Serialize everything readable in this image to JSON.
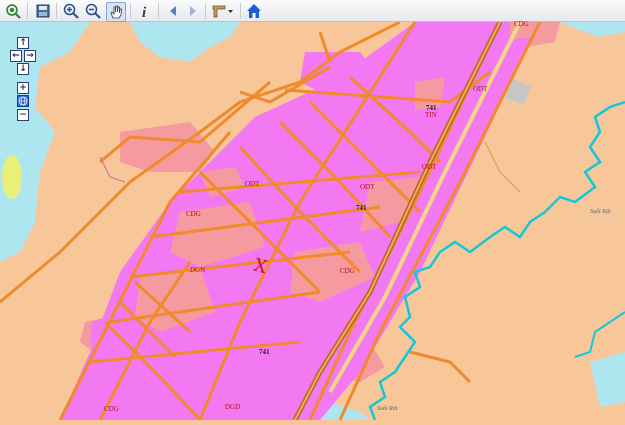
{
  "toolbar": {
    "tools": [
      "zoom-full-icon",
      "save-icon",
      "zoom-in-icon",
      "zoom-out-icon",
      "pan-hand-icon",
      "info-icon",
      "back-arrow-icon",
      "forward-arrow-icon",
      "measure-dropdown-icon",
      "home-icon"
    ]
  },
  "nav": {
    "up": "↑",
    "left": "←",
    "right": "→",
    "down": "↓",
    "zoom_in": "+",
    "zoom_out": "−"
  },
  "labels": {
    "odt1": "ODT",
    "odt2": "ODT",
    "odt3": "ODT",
    "odt4": "ODT",
    "cdg1": "CDG",
    "cdg2": "CDG",
    "cdg3": "CDG",
    "dgn": "DGN",
    "dgd": "DGD",
    "tin": "TIN",
    "cdg_top": "CDG",
    "route1": "741",
    "route2": "741",
    "route3": "741",
    "river1": "Suối Rát",
    "river2": "Suối Rát",
    "marker": "X"
  },
  "colors": {
    "land_agri": "#f7c79a",
    "urban": "#f279f2",
    "commercial": "#f59aa0",
    "road": "#f08a2a",
    "water": "#aee6ef",
    "river_line": "#12c8d8",
    "forest_green": "#e8f07a"
  }
}
